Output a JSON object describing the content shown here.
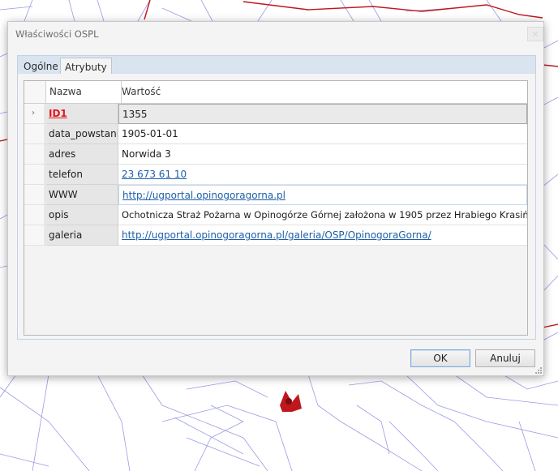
{
  "dialog": {
    "title": "Właściwości OSPL",
    "tabs": [
      {
        "label": "Ogólne",
        "active": false
      },
      {
        "label": "Atrybuty",
        "active": true
      }
    ],
    "grid": {
      "columns": [
        "Nazwa",
        "Wartość"
      ],
      "rows": [
        {
          "name": "ID1",
          "value": "1355"
        },
        {
          "name": "data_powstania",
          "value": "1905-01-01"
        },
        {
          "name": "adres",
          "value": "Norwida 3"
        },
        {
          "name": "telefon",
          "value": "23 673 61 10"
        },
        {
          "name": "WWW",
          "value": "http://ugportal.opinogoragorna.pl"
        },
        {
          "name": "opis",
          "value": "Ochotnicza Straż Pożarna w Opinogórze Górnej założona w 1905 przez Hrabiego Krasińskiego"
        },
        {
          "name": "galeria",
          "value": "http://ugportal.opinogoragorna.pl/galeria/OSP/OpinogoraGorna/"
        }
      ]
    },
    "buttons": {
      "ok": "OK",
      "cancel": "Anuluj"
    }
  },
  "icons": {
    "current_row": "chevron-right-icon",
    "close": "close-icon",
    "resize": "resize-grip-icon",
    "map_marker": "osp-marker-icon"
  },
  "colors": {
    "id_label": "#e3171f",
    "link": "#1d5fa8",
    "map_lines": "#7b7bd6",
    "map_boundary": "#c0161d"
  }
}
